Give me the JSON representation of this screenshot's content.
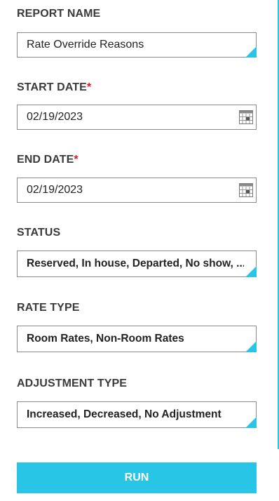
{
  "report_name": {
    "label": "REPORT NAME",
    "value": "Rate Override Reasons"
  },
  "start_date": {
    "label": "START DATE",
    "required_mark": "*",
    "value": "02/19/2023",
    "icon": "calendar-icon"
  },
  "end_date": {
    "label": "END DATE",
    "required_mark": "*",
    "value": "02/19/2023",
    "icon": "calendar-icon"
  },
  "status": {
    "label": "STATUS",
    "value": "Reserved, In house, Departed, No show, ..."
  },
  "rate_type": {
    "label": "RATE TYPE",
    "value": "Room Rates, Non-Room Rates"
  },
  "adjustment_type": {
    "label": "ADJUSTMENT TYPE",
    "value": "Increased, Decreased, No Adjustment"
  },
  "run_button": {
    "label": "RUN"
  },
  "colors": {
    "accent": "#29c5e6",
    "required": "#e0161e"
  }
}
